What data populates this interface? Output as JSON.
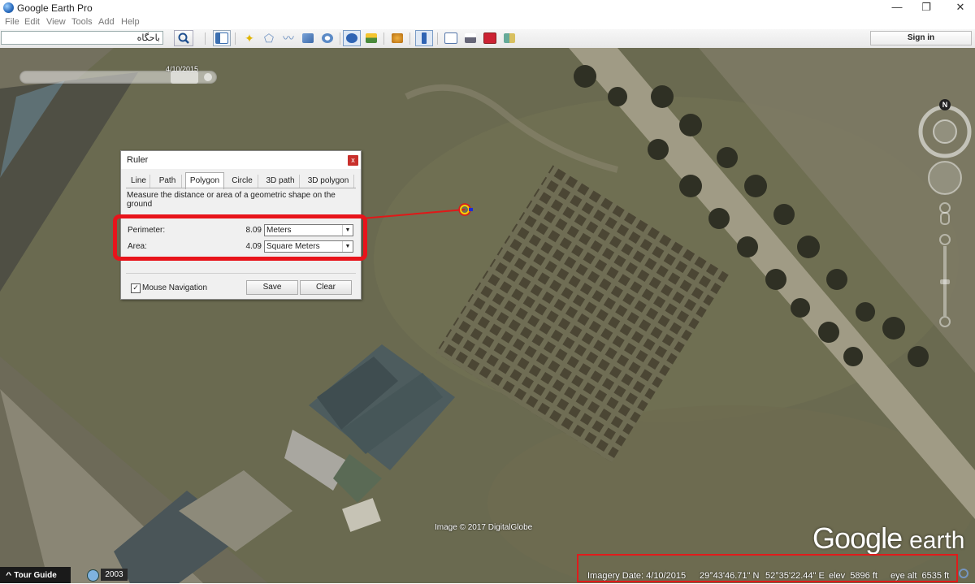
{
  "window": {
    "title": "Google Earth Pro",
    "minimize": "—",
    "maximize": "❐",
    "close": "✕"
  },
  "menu": {
    "items": [
      "File",
      "Edit",
      "View",
      "Tools",
      "Add",
      "Help"
    ]
  },
  "toolbar": {
    "search_value": "باحگاه",
    "sign_in": "Sign in",
    "icons": [
      "sidebar-toggle-icon",
      "placemark-icon",
      "polygon-icon",
      "path-icon",
      "image-overlay-icon",
      "record-tour-icon",
      "historical-imagery-icon",
      "sunlight-icon",
      "planets-icon",
      "ruler-icon",
      "email-icon",
      "print-icon",
      "save-image-icon",
      "google-maps-icon"
    ]
  },
  "map": {
    "time_slider_date": "4/10/2015",
    "compass_north": "N",
    "image_credit": "Image © 2017 DigitalGlobe",
    "logo": {
      "google": "Google",
      "earth": "earth"
    }
  },
  "ruler": {
    "title": "Ruler",
    "close": "x",
    "tabs": [
      "Line",
      "Path",
      "Polygon",
      "Circle",
      "3D path",
      "3D polygon"
    ],
    "active_tab": "Polygon",
    "description": "Measure the distance or area of a geometric shape on the ground",
    "perimeter": {
      "label": "Perimeter:",
      "value": "8.09",
      "unit": "Meters"
    },
    "area": {
      "label": "Area:",
      "value": "4.09",
      "unit": "Square Meters"
    },
    "mouse_navigation": {
      "label": "Mouse Navigation",
      "checked": "✓"
    },
    "save": "Save",
    "clear": "Clear"
  },
  "status": {
    "tour_guide": "Tour Guide",
    "tour_guide_icon": "^",
    "history_year": "2003",
    "imagery_date": "Imagery Date: 4/10/2015",
    "latitude": "29°43'46.71\" N",
    "longitude": "52°35'22.44\" E",
    "elev": "elev  5896 ft",
    "eye_alt": "eye alt  6535 ft"
  },
  "colors": {
    "highlight": "#e8141b",
    "ruler_line": "#e01818"
  }
}
